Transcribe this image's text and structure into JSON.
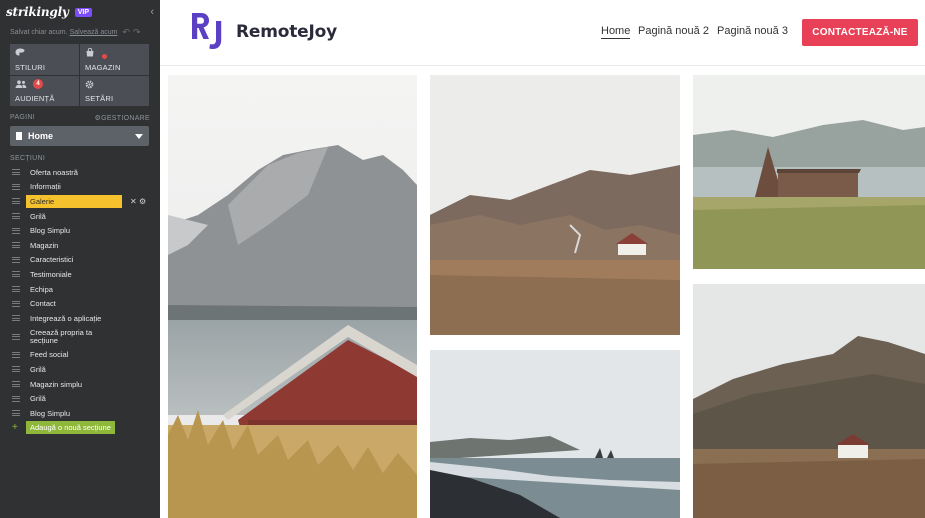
{
  "editor": {
    "logo": "strikingly",
    "vip": "VIP",
    "saved_text": "Salvat chiar acum.",
    "save_link": "Salvează acum",
    "tiles": [
      {
        "label": "STILURI",
        "icon": "palette-icon"
      },
      {
        "label": "MAGAZIN",
        "icon": "shopping-bag-icon"
      },
      {
        "label": "AUDIENȚĂ",
        "icon": "people-icon",
        "badge": "4"
      },
      {
        "label": "SETĂRI",
        "icon": "gear-icon"
      }
    ],
    "pages_label": "PAGINI",
    "manage_label": "GESTIONARE",
    "current_page": "Home",
    "sections_label": "SECȚIUNI",
    "sections": [
      "Oferta noastră",
      "Informații",
      "Galerie",
      "Grilă",
      "Blog Simplu",
      "Magazin",
      "Caracteristici",
      "Testimoniale",
      "Echipa",
      "Contact",
      "Integrează o aplicație",
      "Creează propria ta secțiune",
      "Feed social",
      "Grilă",
      "Magazin simplu",
      "Grilă",
      "Blog Simplu"
    ],
    "active_section_index": 2,
    "add_section": "Adaugă o nouă secțiune"
  },
  "site": {
    "brand_mark": "RJ",
    "brand_name": "RemoteJoy",
    "nav": [
      "Home",
      "Pagină nouă 2",
      "Pagină nouă 3"
    ],
    "cta": "CONTACTEAZĂ-NE"
  },
  "colors": {
    "sidebar_bg": "#2f3133",
    "active_section": "#f5c22e",
    "add_section": "#8fb83a",
    "cta": "#e84056",
    "brand_mark": "#5b3fc4"
  }
}
